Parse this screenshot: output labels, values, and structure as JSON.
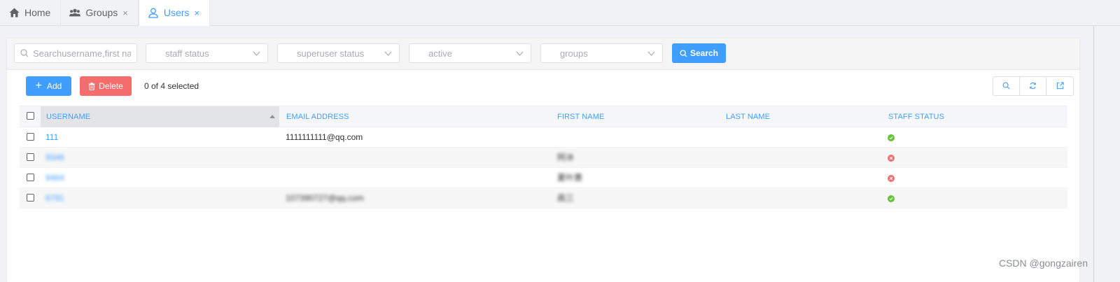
{
  "tabs": [
    {
      "label": "Home",
      "icon": "home-icon",
      "closable": false,
      "active": false
    },
    {
      "label": "Groups",
      "icon": "users-group-icon",
      "closable": true,
      "active": false
    },
    {
      "label": "Users",
      "icon": "user-icon",
      "closable": true,
      "active": true
    }
  ],
  "tab_close_glyph": "×",
  "filters": {
    "search_placeholder": "Searchusername,first name",
    "staff_status": "staff status",
    "superuser_status": "superuser status",
    "active": "active",
    "groups": "groups",
    "search_button": "Search"
  },
  "toolbar": {
    "add_label": "Add",
    "add_glyph": "+",
    "delete_label": "Delete",
    "selection_text": "0 of 4 selected"
  },
  "table": {
    "columns": [
      "USERNAME",
      "EMAIL ADDRESS",
      "FIRST NAME",
      "LAST NAME",
      "STAFF STATUS"
    ],
    "rows": [
      {
        "username": "111",
        "email": "1111111111@qq.com",
        "first_name": "",
        "last_name": "",
        "staff_status": true,
        "blurred": false
      },
      {
        "username": "9346",
        "email": "",
        "first_name": "阿冰",
        "last_name": "",
        "staff_status": false,
        "blurred": true
      },
      {
        "username": "9464",
        "email": "",
        "first_name": "夏叶惠",
        "last_name": "",
        "staff_status": false,
        "blurred": true
      },
      {
        "username": "6791",
        "email": "107390727@qq.com",
        "first_name": "高三",
        "last_name": "",
        "staff_status": true,
        "blurred": true
      }
    ]
  },
  "colors": {
    "primary": "#409eff",
    "danger": "#f56c6c",
    "success": "#67c23a"
  },
  "watermark": "CSDN @gongzairen"
}
